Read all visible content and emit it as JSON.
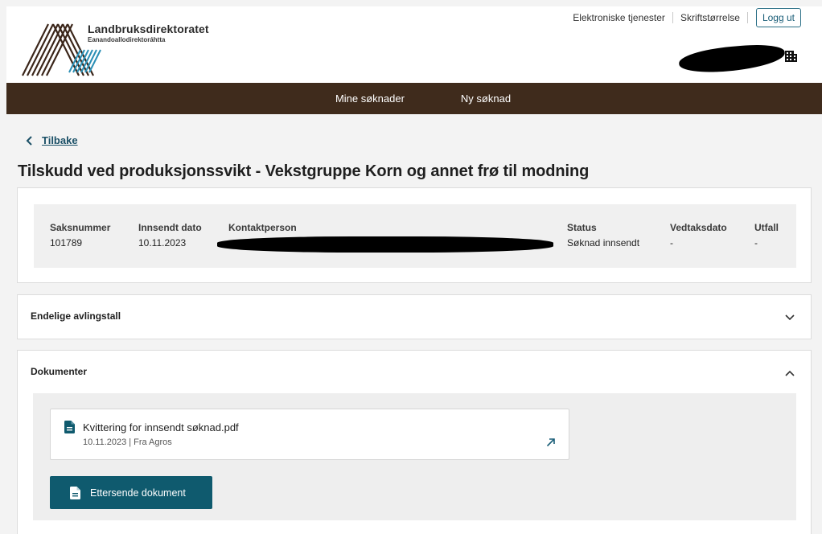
{
  "header": {
    "org_name": "Landbruksdirektoratet",
    "org_subtitle": "Eanandoallodirektoráhtta",
    "links": [
      "Elektroniske tjenester",
      "Skriftstørrelse"
    ],
    "logout_label": "Logg ut"
  },
  "nav": {
    "items": [
      "Mine søknader",
      "Ny søknad"
    ]
  },
  "back_label": "Tilbake",
  "page_title": "Tilskudd ved produksjonssvikt - Vekstgruppe Korn og annet frø til modning",
  "summary": {
    "fields": [
      {
        "label": "Saksnummer",
        "value": "101789"
      },
      {
        "label": "Innsendt dato",
        "value": "10.11.2023"
      },
      {
        "label": "Kontaktperson",
        "value": ""
      },
      {
        "label": "Status",
        "value": "Søknad innsendt"
      },
      {
        "label": "Vedtaksdato",
        "value": "-"
      },
      {
        "label": "Utfall",
        "value": "-"
      }
    ]
  },
  "sections": [
    {
      "title": "Endelige avlingstall",
      "expanded": false
    },
    {
      "title": "Dokumenter",
      "expanded": true
    }
  ],
  "documents": [
    {
      "name": "Kvittering for innsendt søknad.pdf",
      "date": "10.11.2023",
      "source": "Fra Agros"
    }
  ],
  "upload_label": "Ettersende dokument",
  "colors": {
    "nav_bg": "#3f2b1c",
    "primary": "#0f5a6e",
    "link": "#1a4f66"
  },
  "icons": [
    "building-icon",
    "chevron-left-icon",
    "chevron-down-icon",
    "chevron-up-icon",
    "document-icon",
    "external-link-icon"
  ]
}
